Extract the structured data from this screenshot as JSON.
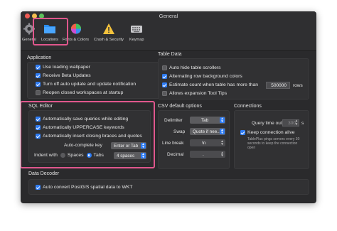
{
  "window": {
    "title": "General"
  },
  "toolbar": {
    "items": [
      {
        "label": "General",
        "icon": "gear-icon"
      },
      {
        "label": "Locations",
        "icon": "folder-icon"
      },
      {
        "label": "Fonts & Colors",
        "icon": "color-wheel-icon"
      },
      {
        "label": "Crash & Security",
        "icon": "warning-icon"
      },
      {
        "label": "Keymap",
        "icon": "keyboard-icon"
      }
    ]
  },
  "application": {
    "title": "Application",
    "options": [
      {
        "label": "Use loading wallpaper",
        "checked": true
      },
      {
        "label": "Receive Beta Updates",
        "checked": true
      },
      {
        "label": "Turn off auto update and update notification",
        "checked": true
      },
      {
        "label": "Reopen closed workspaces at startup",
        "checked": false
      }
    ]
  },
  "table_data": {
    "title": "Table Data",
    "options": [
      {
        "label": "Auto hide table scrollers",
        "checked": false
      },
      {
        "label": "Alternating row background colors",
        "checked": true
      },
      {
        "label": "Estimate count when table has more than",
        "checked": true
      },
      {
        "label": "Allows expansion Tool Tips",
        "checked": false
      }
    ],
    "row_threshold": "500000",
    "rows_suffix": "rows"
  },
  "sql_editor": {
    "title": "SQL Editor",
    "options": [
      {
        "label": "Automatically save queries while editing",
        "checked": true
      },
      {
        "label": "Automatically UPPERCASE keywords",
        "checked": true
      },
      {
        "label": "Automatically insert closing braces and quotes",
        "checked": true
      }
    ],
    "auto_complete_label": "Auto-complete key",
    "auto_complete_value": "Enter or Tab",
    "indent_label": "Indent with",
    "indent_options": [
      {
        "label": "Spaces",
        "selected": false
      },
      {
        "label": "Tabs",
        "selected": true
      }
    ],
    "indent_size": "4 spaces"
  },
  "csv": {
    "title": "CSV default options",
    "fields": [
      {
        "label": "Delimiter",
        "value": "Tab"
      },
      {
        "label": "Swap",
        "value": "Quote if nee..."
      },
      {
        "label": "Line break",
        "value": "\\n"
      },
      {
        "label": "Decimal",
        "value": "."
      }
    ]
  },
  "connections": {
    "title": "Connections",
    "query_timeout_label": "Query time out",
    "query_timeout_value": "300",
    "query_timeout_unit": "s",
    "keep_alive": {
      "label": "Keep connection alive",
      "checked": true
    },
    "keep_alive_note": [
      "TablePlus pings servers every 30",
      "seconds to keep the connection",
      "open"
    ]
  },
  "data_decoder": {
    "title": "Data Decoder",
    "option": {
      "label": "Auto convert PostGIS spatial data to WKT",
      "checked": true
    }
  },
  "colors": {
    "accent": "#2f7df6",
    "highlight": "#e0578d",
    "window_bg": "#2a2a2c"
  }
}
